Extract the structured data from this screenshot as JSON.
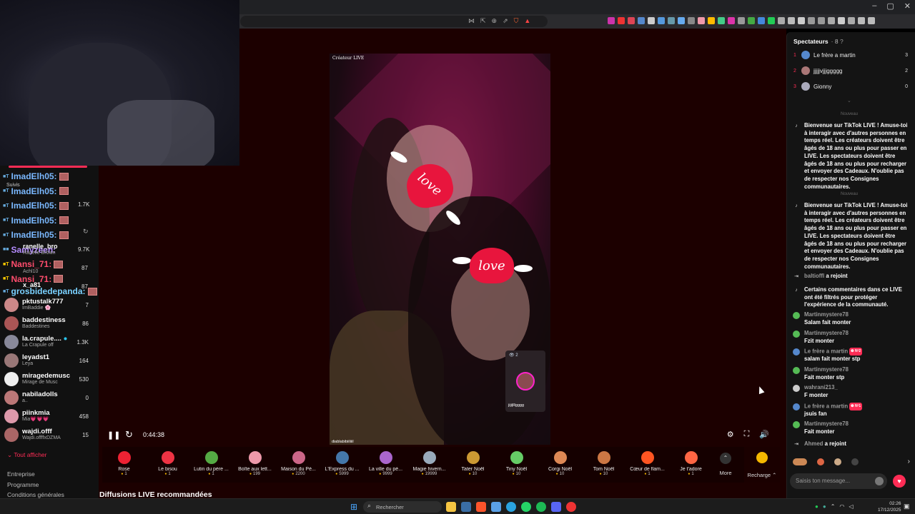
{
  "browser": {
    "window_controls": [
      "–",
      "▢",
      "✕"
    ]
  },
  "sidebar_overlay": {
    "chat_lines": [
      {
        "tag": "■T",
        "name": "ImadElh05:"
      },
      {
        "tag": "■T",
        "name": "ImadElh05:"
      },
      {
        "tag": "■T",
        "name": "ImadElh05:"
      },
      {
        "tag": "■T",
        "name": "ImadElh05:"
      },
      {
        "tag": "■T",
        "name": "ImadElh05:"
      },
      {
        "tag": "■■",
        "name": "Samyzeen:"
      },
      {
        "tag": "■T",
        "name": "Nansi_71:"
      },
      {
        "tag": "■T",
        "name": "Nansi_71:"
      },
      {
        "tag": "■T",
        "name": "grosbidedepanda:"
      }
    ],
    "hidden_labels": {
      "suivis": "Suivis",
      "counts": [
        "1.7K",
        "9.7K",
        "87",
        "87"
      ],
      "creator_fragments": [
        "ranelle_bro",
        "Ranelle Brown",
        "Achl10",
        "x_a81"
      ]
    }
  },
  "creators": [
    {
      "name": "pktustalk777",
      "sub": "ImBaddie 🌸",
      "count": "7",
      "color": "#c88"
    },
    {
      "name": "baddestiness",
      "sub": "Baddestines",
      "count": "86",
      "color": "#a55"
    },
    {
      "name": "la.crapule....",
      "sub": "La Crapule off",
      "count": "1.3K",
      "color": "#889"
    },
    {
      "name": "leyadst1",
      "sub": "Leya",
      "count": "164",
      "color": "#977"
    },
    {
      "name": "miragedemusc",
      "sub": "Mirage de Musc",
      "count": "530",
      "color": "#eee"
    },
    {
      "name": "nabiladolls",
      "sub": "a..",
      "count": "0",
      "color": "#b77"
    },
    {
      "name": "piinkmia",
      "sub": "Mia💗💗💗",
      "count": "458",
      "color": "#d9a"
    },
    {
      "name": "wajdi.offf",
      "sub": "Wajdi.offffxDZMA",
      "count": "15",
      "color": "#a66"
    }
  ],
  "show_all": "⌄ Tout afficher",
  "footer_links": [
    "Entreprise",
    "Programme",
    "Conditions générales"
  ],
  "video": {
    "label": "Créateur LIVE",
    "sticker_text": "love",
    "host": "diablabibiiliiil",
    "pip": {
      "count": "👁 2",
      "name": "jijijlllgggg"
    }
  },
  "player": {
    "time": "0:44:38",
    "play_icon": "❚❚",
    "refresh_icon": "↻",
    "right_icons": [
      "⚙",
      "⛶",
      "🔊"
    ]
  },
  "gifts": [
    {
      "name": "Rose",
      "price": "1",
      "color": "#e23"
    },
    {
      "name": "Le bisou",
      "price": "1",
      "color": "#e34"
    },
    {
      "name": "Lutin du père ...",
      "price": "1",
      "color": "#5a4"
    },
    {
      "name": "Boîte aux lett...",
      "price": "199",
      "color": "#e9a"
    },
    {
      "name": "Maison du Pè...",
      "price": "2200",
      "color": "#c68"
    },
    {
      "name": "L'Express du ...",
      "price": "5999",
      "color": "#47a"
    },
    {
      "name": "La ville du pè...",
      "price": "9999",
      "color": "#a6c"
    },
    {
      "name": "Magie hivern...",
      "price": "19999",
      "color": "#9ab"
    },
    {
      "name": "Tater Noël",
      "price": "10",
      "color": "#c93"
    },
    {
      "name": "Tiny Noël",
      "price": "10",
      "color": "#6c6"
    },
    {
      "name": "Corgi Noël",
      "price": "10",
      "color": "#d85"
    },
    {
      "name": "Tom Noël",
      "price": "10",
      "color": "#c74"
    },
    {
      "name": "Cœur de flam...",
      "price": "1",
      "color": "#f52"
    },
    {
      "name": "Je t'adore",
      "price": "1",
      "color": "#f64"
    }
  ],
  "more_label": "More",
  "more_icon": "⌃",
  "recharge_label": "Recharge ⌃",
  "recommended_title": "Diffusions LIVE recommandées",
  "viewers": {
    "title": "Spectateurs",
    "count": "· 8",
    "list": [
      {
        "rank": "1",
        "name": "Le frère a martin",
        "score": "3",
        "color": "#58c"
      },
      {
        "rank": "2",
        "name": "jjjjjvjjjggggg",
        "score": "2",
        "color": "#a77"
      },
      {
        "rank": "3",
        "name": "Gionny",
        "score": "0",
        "color": "#aab"
      }
    ]
  },
  "chat": {
    "divider_label": "Nouveau",
    "welcome": "Bienvenue sur TikTok LIVE ! Amuse-toi à interagir avec d'autres personnes en temps réel. Les créateurs doivent être âgés de 18 ans ou plus pour passer en LIVE. Les spectateurs doivent être âgés de 18 ans ou plus pour recharger et envoyer des Cadeaux. N'oublie pas de respecter nos Consignes communautaires.",
    "joined1_user": "baltioffl",
    "joined_text": "a rejoint",
    "filter_notice": "Certains commentaires dans ce LIVE ont été filtrés pour protéger l'expérience de la communauté.",
    "messages": [
      {
        "user": "Martinmystere78",
        "text": "Salam fait monter",
        "badge": "",
        "color": "#5b5"
      },
      {
        "user": "Martinmystere78",
        "text": "Fzit monter",
        "badge": "",
        "color": "#5b5"
      },
      {
        "user": "Le frère a martin",
        "text": "salam fait monter stp",
        "badge": "❸ Nº2",
        "color": "#58c"
      },
      {
        "user": "Martinmystere78",
        "text": "Fait monter stp",
        "badge": "",
        "color": "#5b5"
      },
      {
        "user": "wahrani213_",
        "text": "F monter",
        "badge": "",
        "color": "#ccc"
      },
      {
        "user": "Le frère a martin",
        "text": "jsuis fan",
        "badge": "❸ Nº1",
        "color": "#58c"
      },
      {
        "user": "Martinmystere78",
        "text": "Fait monter",
        "badge": "",
        "color": "#5b5"
      }
    ],
    "joined2_user": "Ahmed",
    "input_placeholder": "Saisis ton message...",
    "send_heart": "♥",
    "reactions_next": "›"
  },
  "taskbar": {
    "start": "⊞",
    "search_placeholder": "Rechercher",
    "time": "02:26",
    "date": "17/12/2025"
  },
  "colors": {
    "accent": "#fe2c55",
    "background_main": "#1c0000"
  }
}
